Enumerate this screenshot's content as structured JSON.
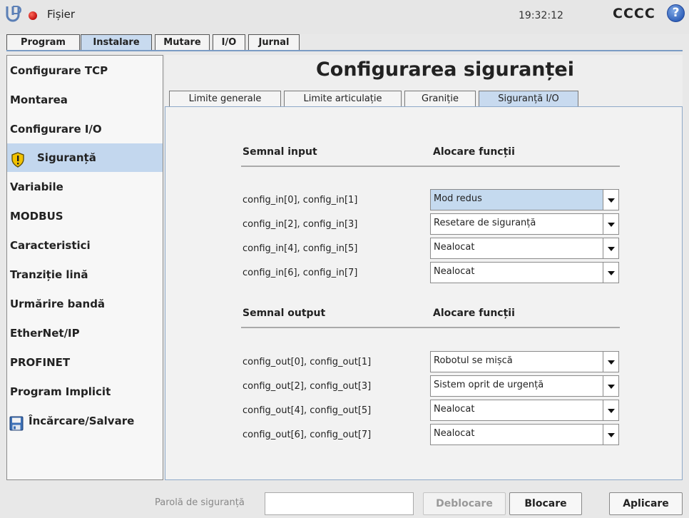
{
  "header": {
    "file_menu": "Fișier",
    "clock": "19:32:12",
    "robot_name": "CCCC",
    "help_label": "?"
  },
  "main_tabs": [
    {
      "label": "Program"
    },
    {
      "label": "Instalare"
    },
    {
      "label": "Mutare"
    },
    {
      "label": "I/O"
    },
    {
      "label": "Jurnal"
    }
  ],
  "sidebar": {
    "items": [
      {
        "label": "Configurare TCP"
      },
      {
        "label": "Montarea"
      },
      {
        "label": "Configurare I/O"
      },
      {
        "label": "Siguranță"
      },
      {
        "label": "Variabile"
      },
      {
        "label": "MODBUS"
      },
      {
        "label": "Caracteristici"
      },
      {
        "label": "Tranziție lină"
      },
      {
        "label": "Urmărire bandă"
      },
      {
        "label": "EtherNet/IP"
      },
      {
        "label": "PROFINET"
      },
      {
        "label": "Program Implicit"
      },
      {
        "label": "Încărcare/Salvare"
      }
    ]
  },
  "page_title": "Configurarea siguranței",
  "sub_tabs": [
    {
      "label": "Limite generale"
    },
    {
      "label": "Limite articulație"
    },
    {
      "label": "Graniție"
    },
    {
      "label": "Siguranță I/O"
    }
  ],
  "inputs_section": {
    "signal_header": "Semnal input",
    "function_header": "Alocare funcții",
    "rows": [
      {
        "label": "config_in[0], config_in[1]",
        "value": "Mod redus"
      },
      {
        "label": "config_in[2], config_in[3]",
        "value": "Resetare de siguranță"
      },
      {
        "label": "config_in[4], config_in[5]",
        "value": "Nealocat"
      },
      {
        "label": "config_in[6], config_in[7]",
        "value": "Nealocat"
      }
    ]
  },
  "outputs_section": {
    "signal_header": "Semnal output",
    "function_header": "Alocare funcții",
    "rows": [
      {
        "label": "config_out[0], config_out[1]",
        "value": "Robotul se mișcă"
      },
      {
        "label": "config_out[2], config_out[3]",
        "value": "Sistem oprit de urgență"
      },
      {
        "label": "config_out[4], config_out[5]",
        "value": "Nealocat"
      },
      {
        "label": "config_out[6], config_out[7]",
        "value": "Nealocat"
      }
    ]
  },
  "footer": {
    "password_label": "Parolă de siguranță",
    "password_value": "",
    "unlock_label": "Deblocare",
    "lock_label": "Blocare",
    "apply_label": "Aplicare"
  },
  "colors": {
    "active_tab": "#c8daef",
    "sidebar_active": "#c3d7ee",
    "status_dot": "#d8261a",
    "help_button": "#3a6cc4",
    "warning_icon": "#f2c200"
  }
}
